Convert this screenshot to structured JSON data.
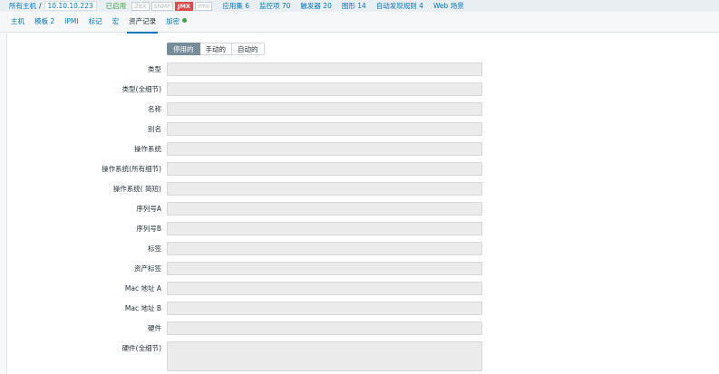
{
  "breadcrumb": {
    "all_hosts": "所有主机",
    "separator": "/",
    "host": "10.10.10.223",
    "status": "已启用",
    "interfaces": [
      "ZBX",
      "SNMP",
      "JMX",
      "IPMI"
    ],
    "nav": [
      "应用集 6",
      "监控项 70",
      "触发器 20",
      "图形 14",
      "自动发现规则 4",
      "Web 场景"
    ]
  },
  "tabs": [
    "主机",
    "模板 2",
    "IPMI",
    "标记",
    "宏",
    "资产记录",
    "加密"
  ],
  "active_tab": "资产记录",
  "inventory_mode": {
    "options": [
      "停用的",
      "手动的",
      "自动的"
    ],
    "selected": "停用的"
  },
  "fields": [
    "类型",
    "类型(全细节)",
    "名称",
    "别名",
    "操作系统",
    "操作系统(所有细节)",
    "操作系统( 简短)",
    "序列号A",
    "序列号B",
    "标签",
    "资产标签",
    "Mac 地址 A",
    "Mac 地址 B",
    "硬件",
    "硬件(全细节)"
  ],
  "colors": {
    "link": "#0275b8",
    "enabled": "#429e47",
    "jmx_badge": "#d64e4e",
    "segment_selected": "#768d99"
  }
}
